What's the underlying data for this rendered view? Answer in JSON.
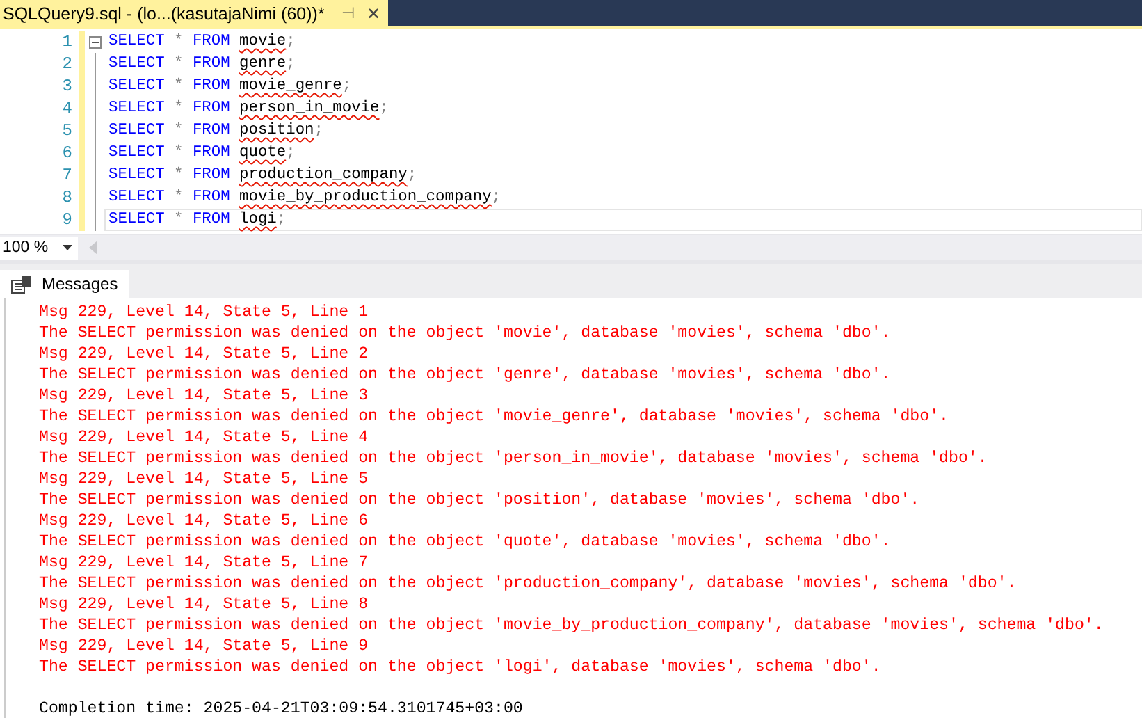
{
  "tab": {
    "title": "SQLQuery9.sql - (lo...(kasutajaNimi (60))*",
    "pin": "⊣",
    "close": "✕",
    "selected": true
  },
  "editor": {
    "lines": [
      {
        "number": "1",
        "current": false,
        "tokens": [
          {
            "text": "SELECT",
            "kind": "keyword"
          },
          {
            "text": "*",
            "kind": "operator"
          },
          {
            "text": "FROM",
            "kind": "keyword"
          },
          {
            "text": "movie",
            "kind": "identifier"
          },
          {
            "text": ";",
            "kind": "punct"
          }
        ]
      },
      {
        "number": "2",
        "current": false,
        "tokens": [
          {
            "text": "SELECT",
            "kind": "keyword"
          },
          {
            "text": "*",
            "kind": "operator"
          },
          {
            "text": "FROM",
            "kind": "keyword"
          },
          {
            "text": "genre",
            "kind": "identifier"
          },
          {
            "text": ";",
            "kind": "punct"
          }
        ]
      },
      {
        "number": "3",
        "current": false,
        "tokens": [
          {
            "text": "SELECT",
            "kind": "keyword"
          },
          {
            "text": "*",
            "kind": "operator"
          },
          {
            "text": "FROM",
            "kind": "keyword"
          },
          {
            "text": "movie_genre",
            "kind": "identifier"
          },
          {
            "text": ";",
            "kind": "punct"
          }
        ]
      },
      {
        "number": "4",
        "current": false,
        "tokens": [
          {
            "text": "SELECT",
            "kind": "keyword"
          },
          {
            "text": "*",
            "kind": "operator"
          },
          {
            "text": "FROM",
            "kind": "keyword"
          },
          {
            "text": "person_in_movie",
            "kind": "identifier"
          },
          {
            "text": ";",
            "kind": "punct"
          }
        ]
      },
      {
        "number": "5",
        "current": false,
        "tokens": [
          {
            "text": "SELECT",
            "kind": "keyword"
          },
          {
            "text": "*",
            "kind": "operator"
          },
          {
            "text": "FROM",
            "kind": "keyword"
          },
          {
            "text": "position",
            "kind": "identifier"
          },
          {
            "text": ";",
            "kind": "punct"
          }
        ]
      },
      {
        "number": "6",
        "current": false,
        "tokens": [
          {
            "text": "SELECT",
            "kind": "keyword"
          },
          {
            "text": "*",
            "kind": "operator"
          },
          {
            "text": "FROM",
            "kind": "keyword"
          },
          {
            "text": "quote",
            "kind": "identifier"
          },
          {
            "text": ";",
            "kind": "punct"
          }
        ]
      },
      {
        "number": "7",
        "current": false,
        "tokens": [
          {
            "text": "SELECT",
            "kind": "keyword"
          },
          {
            "text": "*",
            "kind": "operator"
          },
          {
            "text": "FROM",
            "kind": "keyword"
          },
          {
            "text": "production_company",
            "kind": "identifier"
          },
          {
            "text": ";",
            "kind": "punct"
          }
        ]
      },
      {
        "number": "8",
        "current": false,
        "tokens": [
          {
            "text": "SELECT",
            "kind": "keyword"
          },
          {
            "text": "*",
            "kind": "operator"
          },
          {
            "text": "FROM",
            "kind": "keyword"
          },
          {
            "text": "movie_by_production_company",
            "kind": "identifier"
          },
          {
            "text": ";",
            "kind": "punct"
          }
        ]
      },
      {
        "number": "9",
        "current": true,
        "tokens": [
          {
            "text": "SELECT",
            "kind": "keyword"
          },
          {
            "text": "*",
            "kind": "operator"
          },
          {
            "text": "FROM",
            "kind": "keyword"
          },
          {
            "text": "logi",
            "kind": "identifier"
          },
          {
            "text": ";",
            "kind": "punct"
          }
        ]
      }
    ]
  },
  "zoom": {
    "value": "100 %"
  },
  "results_tabs": [
    {
      "label": "Messages",
      "selected": true
    }
  ],
  "messages": [
    {
      "kind": "error",
      "text": "Msg 229, Level 14, State 5, Line 1"
    },
    {
      "kind": "error",
      "text": "The SELECT permission was denied on the object 'movie', database 'movies', schema 'dbo'."
    },
    {
      "kind": "error",
      "text": "Msg 229, Level 14, State 5, Line 2"
    },
    {
      "kind": "error",
      "text": "The SELECT permission was denied on the object 'genre', database 'movies', schema 'dbo'."
    },
    {
      "kind": "error",
      "text": "Msg 229, Level 14, State 5, Line 3"
    },
    {
      "kind": "error",
      "text": "The SELECT permission was denied on the object 'movie_genre', database 'movies', schema 'dbo'."
    },
    {
      "kind": "error",
      "text": "Msg 229, Level 14, State 5, Line 4"
    },
    {
      "kind": "error",
      "text": "The SELECT permission was denied on the object 'person_in_movie', database 'movies', schema 'dbo'."
    },
    {
      "kind": "error",
      "text": "Msg 229, Level 14, State 5, Line 5"
    },
    {
      "kind": "error",
      "text": "The SELECT permission was denied on the object 'position', database 'movies', schema 'dbo'."
    },
    {
      "kind": "error",
      "text": "Msg 229, Level 14, State 5, Line 6"
    },
    {
      "kind": "error",
      "text": "The SELECT permission was denied on the object 'quote', database 'movies', schema 'dbo'."
    },
    {
      "kind": "error",
      "text": "Msg 229, Level 14, State 5, Line 7"
    },
    {
      "kind": "error",
      "text": "The SELECT permission was denied on the object 'production_company', database 'movies', schema 'dbo'."
    },
    {
      "kind": "error",
      "text": "Msg 229, Level 14, State 5, Line 8"
    },
    {
      "kind": "error",
      "text": "The SELECT permission was denied on the object 'movie_by_production_company', database 'movies', schema 'dbo'."
    },
    {
      "kind": "error",
      "text": "Msg 229, Level 14, State 5, Line 9"
    },
    {
      "kind": "error",
      "text": "The SELECT permission was denied on the object 'logi', database 'movies', schema 'dbo'."
    },
    {
      "kind": "info",
      "text": "Completion time: 2025-04-21T03:09:54.3101745+03:00"
    }
  ]
}
